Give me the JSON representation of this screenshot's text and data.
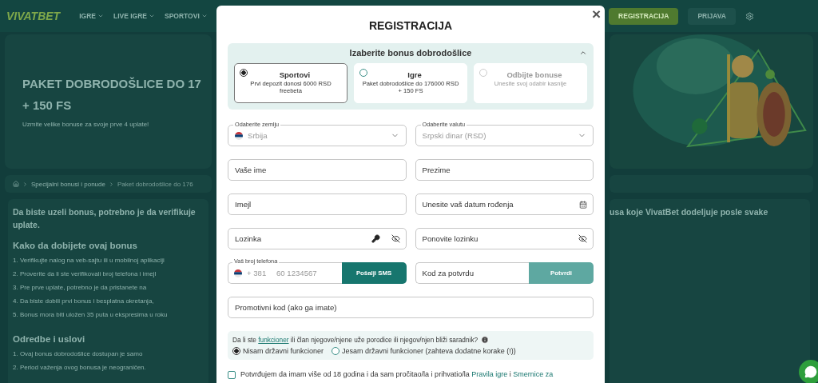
{
  "header": {
    "logo": "VIVATBET",
    "nav": [
      {
        "label": "IGRE"
      },
      {
        "label": "LIVE IGRE"
      },
      {
        "label": "SPORTOVI"
      }
    ],
    "register": "REGISTRACIJA",
    "login": "PRIJAVA"
  },
  "hero": {
    "title": "PAKET DOBRODOŠLICE DO 17",
    "title_line2": "+ 150 FS",
    "subtitle": "Uzmite velike bonuse za svoje prve 4 uplate!"
  },
  "breadcrumb": [
    "Specijalni bonusi i ponude",
    "Paket dobrodošlice do 176"
  ],
  "content": {
    "intro": "Da biste uzeli bonus, potrebno je da verifikuje",
    "intro_line2": "uplate.",
    "intro_right": "usa koje VivatBet dodeljuje posle svake",
    "sections": [
      {
        "heading": "Kako da dobijete ovaj bonus",
        "items": [
          "1. Verifikujte nalog na veb-sajtu ili u mobilnoj aplikaciji",
          "2. Proverite da li ste verifikovali broj telefona i imejl",
          "3. Pre prve uplate, potrebno je da pristanete na",
          "4. Da biste dobili prvi bonus i besplatna okretanja,",
          "5. Bonus mora biti uložen 35 puta u ekspresima u roku"
        ]
      },
      {
        "heading": "Odredbe i uslovi",
        "items": [
          "1. Ovaj bonus dobrodošlice dostupan je samo",
          "2. Period važenja ovog bonusa je neograničen."
        ]
      }
    ]
  },
  "modal": {
    "title": "REGISTRACIJA",
    "close": "×",
    "bonus": {
      "title": "Izaberite bonus dobrodošlice",
      "expanded": true,
      "options": [
        {
          "title": "Sportovi",
          "text": "Prvi depozit donosi 6000 RSD freebeta",
          "selected": true,
          "disabled": false
        },
        {
          "title": "Igre",
          "text": "Paket dobrodošlice do 176000 RSD + 150 FS",
          "selected": false,
          "disabled": false
        },
        {
          "title": "Odbijte bonuse",
          "text": "Unesite svoj odabir kasnije",
          "selected": false,
          "disabled": true
        }
      ]
    },
    "rows": [
      [
        {
          "kind": "select",
          "label": "Odaberite zemlju",
          "value": "Srbija",
          "flag": true
        },
        {
          "kind": "select",
          "label": "Odaberite valutu",
          "value": "Srpski dinar (RSD)",
          "flag": false
        }
      ],
      [
        {
          "kind": "text",
          "placeholder": "Vaše ime"
        },
        {
          "kind": "text",
          "placeholder": "Prezime"
        }
      ],
      [
        {
          "kind": "text",
          "placeholder": "Imejl"
        },
        {
          "kind": "date",
          "placeholder": "Unesite vaš datum rođenja"
        }
      ],
      [
        {
          "kind": "password",
          "placeholder": "Lozinka",
          "generator": true
        },
        {
          "kind": "password",
          "placeholder": "Ponovite lozinku",
          "generator": false
        }
      ],
      [
        {
          "kind": "phone",
          "label": "Vaš broj telefona",
          "prefix": "+ 381",
          "placeholder": "60 1234567",
          "button": "Pošalji SMS",
          "disabled": false
        },
        {
          "kind": "code",
          "placeholder": "Kod za potvrdu",
          "button": "Potvrdi",
          "disabled": true
        }
      ],
      [
        {
          "kind": "text",
          "placeholder": "Promotivni kod (ako ga imate)"
        }
      ]
    ],
    "pep": {
      "question": [
        {
          "kind": "text",
          "text": "Da li ste "
        },
        {
          "kind": "link",
          "text": "funkcioner"
        },
        {
          "kind": "text",
          "text": " ili član njegove/njene uže porodice ili njegov/njen bliži saradnik?"
        }
      ],
      "options": [
        {
          "label": "Nisam državni funkcioner",
          "selected": true
        },
        {
          "label": "Jesam državni funkcioner (zahteva dodatne korake (!))",
          "selected": false
        }
      ]
    },
    "terms": {
      "checked": false,
      "parts": [
        {
          "kind": "text",
          "text": "Potvrđujem da imam više od 18 godina i da sam pročitao/la i prihvatio/la "
        },
        {
          "kind": "link",
          "text": "Pravila igre"
        },
        {
          "kind": "text",
          "text": " i "
        },
        {
          "kind": "link",
          "text": "Smernice za"
        }
      ]
    }
  }
}
